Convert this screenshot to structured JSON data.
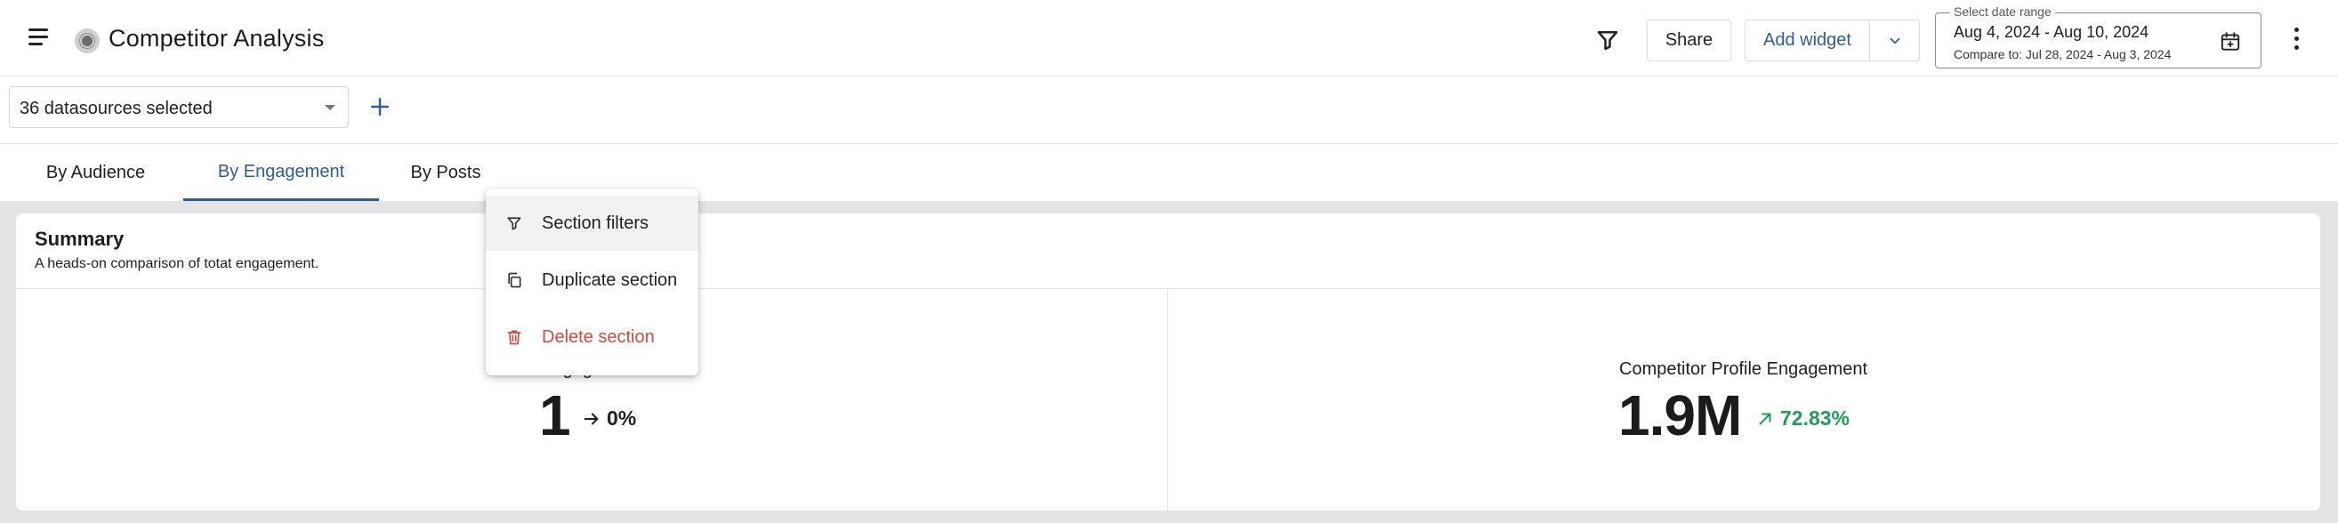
{
  "header": {
    "title": "Competitor Analysis",
    "share_label": "Share",
    "add_widget_label": "Add widget",
    "date_range": {
      "legend": "Select date range",
      "value": "Aug 4, 2024 - Aug 10, 2024",
      "compare": "Compare to: Jul 28, 2024 - Aug 3, 2024"
    }
  },
  "datasources": {
    "selected_label": "36 datasources selected"
  },
  "tabs": [
    {
      "label": "By Audience",
      "active": false
    },
    {
      "label": "By Engagement",
      "active": true
    },
    {
      "label": "By Posts",
      "active": false
    }
  ],
  "summary": {
    "title": "Summary",
    "subtitle": "A heads-on comparison of totat engagement.",
    "metrics": [
      {
        "label": "Engagement",
        "value": "1",
        "change": "0%",
        "trend": "flat",
        "change_color": "#1f1f1f"
      },
      {
        "label": "Competitor Profile Engagement",
        "value": "1.9M",
        "change": "72.83%",
        "trend": "up",
        "change_color": "#1f9d55"
      }
    ]
  },
  "context_menu": {
    "items": [
      {
        "label": "Section filters",
        "icon": "filter-icon"
      },
      {
        "label": "Duplicate section",
        "icon": "copy-icon"
      },
      {
        "label": "Delete section",
        "icon": "trash-icon",
        "color": "#d14a3a"
      }
    ]
  },
  "colors": {
    "accent": "#2f5c9b",
    "positive": "#1f9d55",
    "danger": "#d14a3a",
    "content_background": "#e4e4e4"
  }
}
